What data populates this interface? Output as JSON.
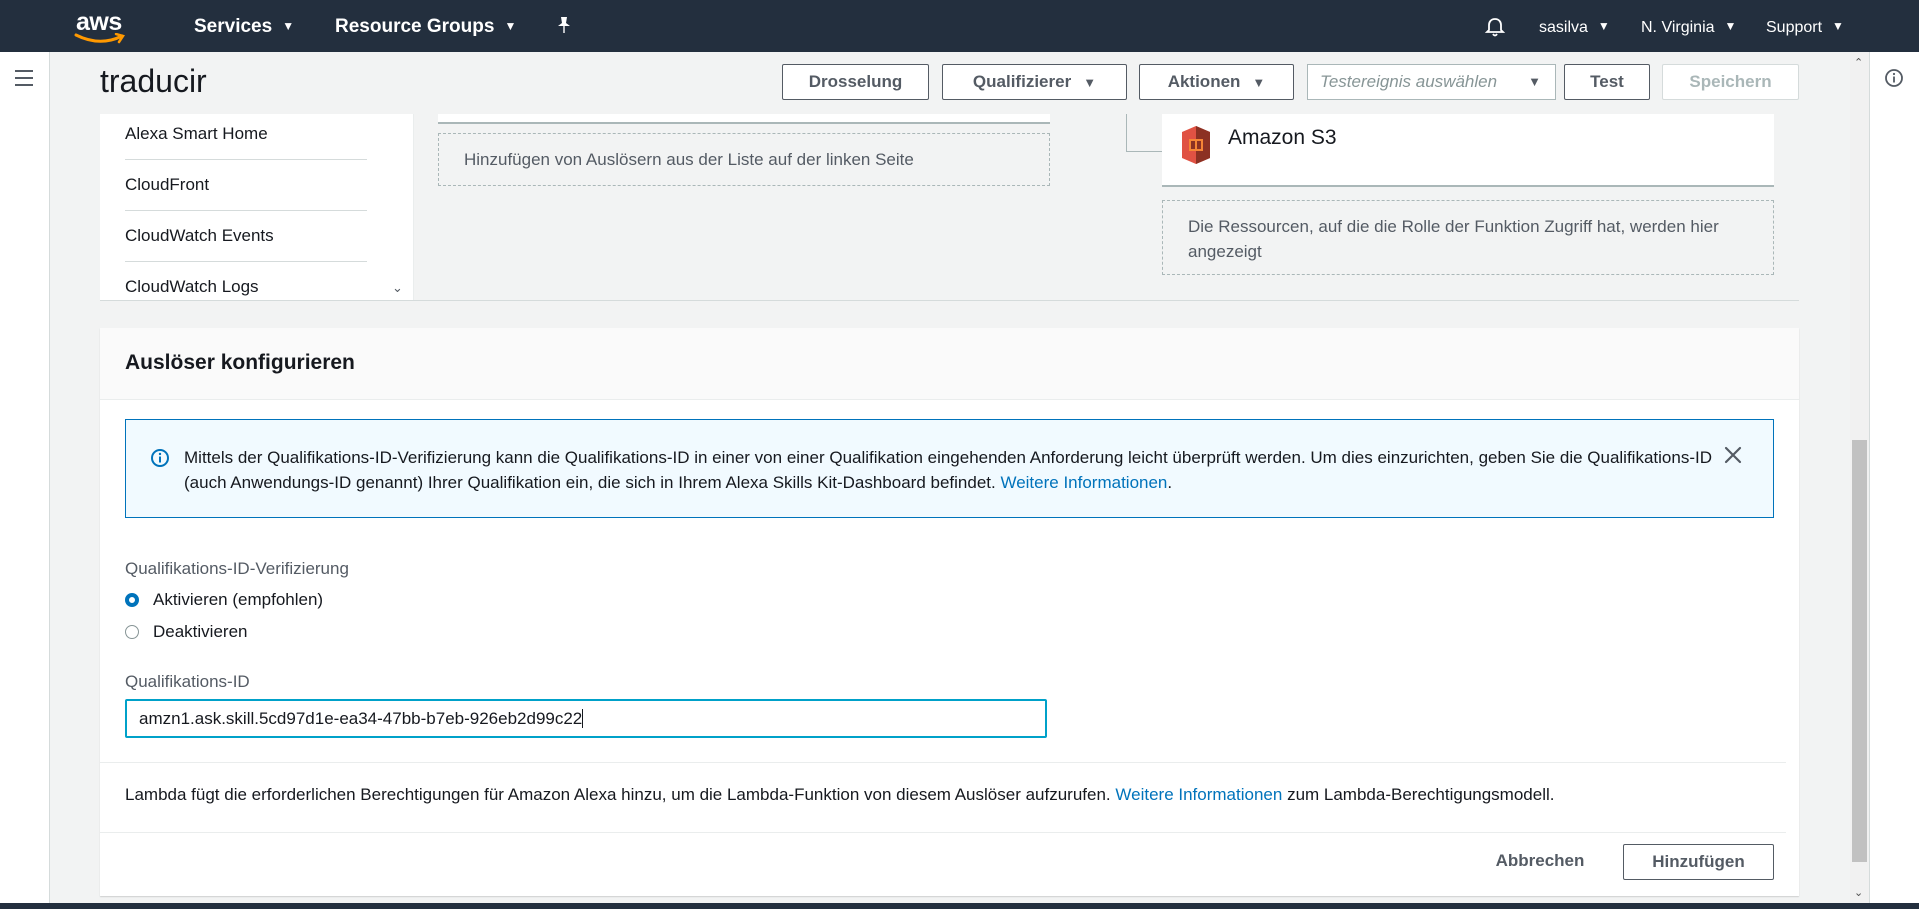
{
  "topnav": {
    "logo_text": "aws",
    "services": "Services",
    "resource_groups": "Resource Groups",
    "user": "sasilva",
    "region": "N. Virginia",
    "support": "Support"
  },
  "header": {
    "function_name": "traducir",
    "throttle": "Drosselung",
    "qualifier": "Qualifizierer",
    "actions": "Aktionen",
    "test_event_placeholder": "Testereignis auswählen",
    "test": "Test",
    "save": "Speichern"
  },
  "designer": {
    "trigger_list": [
      "Alexa Smart Home",
      "CloudFront",
      "CloudWatch Events",
      "CloudWatch Logs"
    ],
    "add_triggers_hint": "Hinzufügen von Auslösern aus der Liste auf der linken Seite",
    "resource_name": "Amazon S3",
    "resources_hint": "Die Ressourcen, auf die die Rolle der Funktion Zugriff hat, werden hier angezeigt"
  },
  "config": {
    "heading": "Auslöser konfigurieren",
    "alert_text": "Mittels der Qualifikations-ID-Verifizierung kann die Qualifikations-ID in einer von einer Qualifikation eingehenden Anforderung leicht überprüft werden. Um dies einzurichten, geben Sie die Qualifikations-ID (auch Anwendungs-ID genannt) Ihrer Qualifikation ein, die sich in Ihrem Alexa Skills Kit-Dashboard befindet.",
    "alert_link": "Weitere Informationen",
    "alert_end": ".",
    "verification_label": "Qualifikations-ID-Verifizierung",
    "option_enable": "Aktivieren (empfohlen)",
    "option_disable": "Deaktivieren",
    "selected_option": "Aktivieren (empfohlen)",
    "skill_id_label": "Qualifikations-ID",
    "skill_id_value": "amzn1.ask.skill.5cd97d1e-ea34-47bb-b7eb-926eb2d99c22",
    "note_text": "Lambda fügt die erforderlichen Berechtigungen für Amazon Alexa hinzu, um die Lambda-Funktion von diesem Auslöser aufzurufen.",
    "note_link": "Weitere Informationen",
    "note_end": "zum Lambda-Berechtigungsmodell.",
    "cancel": "Abbrechen",
    "add": "Hinzufügen"
  },
  "colors": {
    "nav_bg": "#232f3e",
    "link": "#0073bb",
    "accent": "#ff9900",
    "focus": "#00a1c9"
  }
}
